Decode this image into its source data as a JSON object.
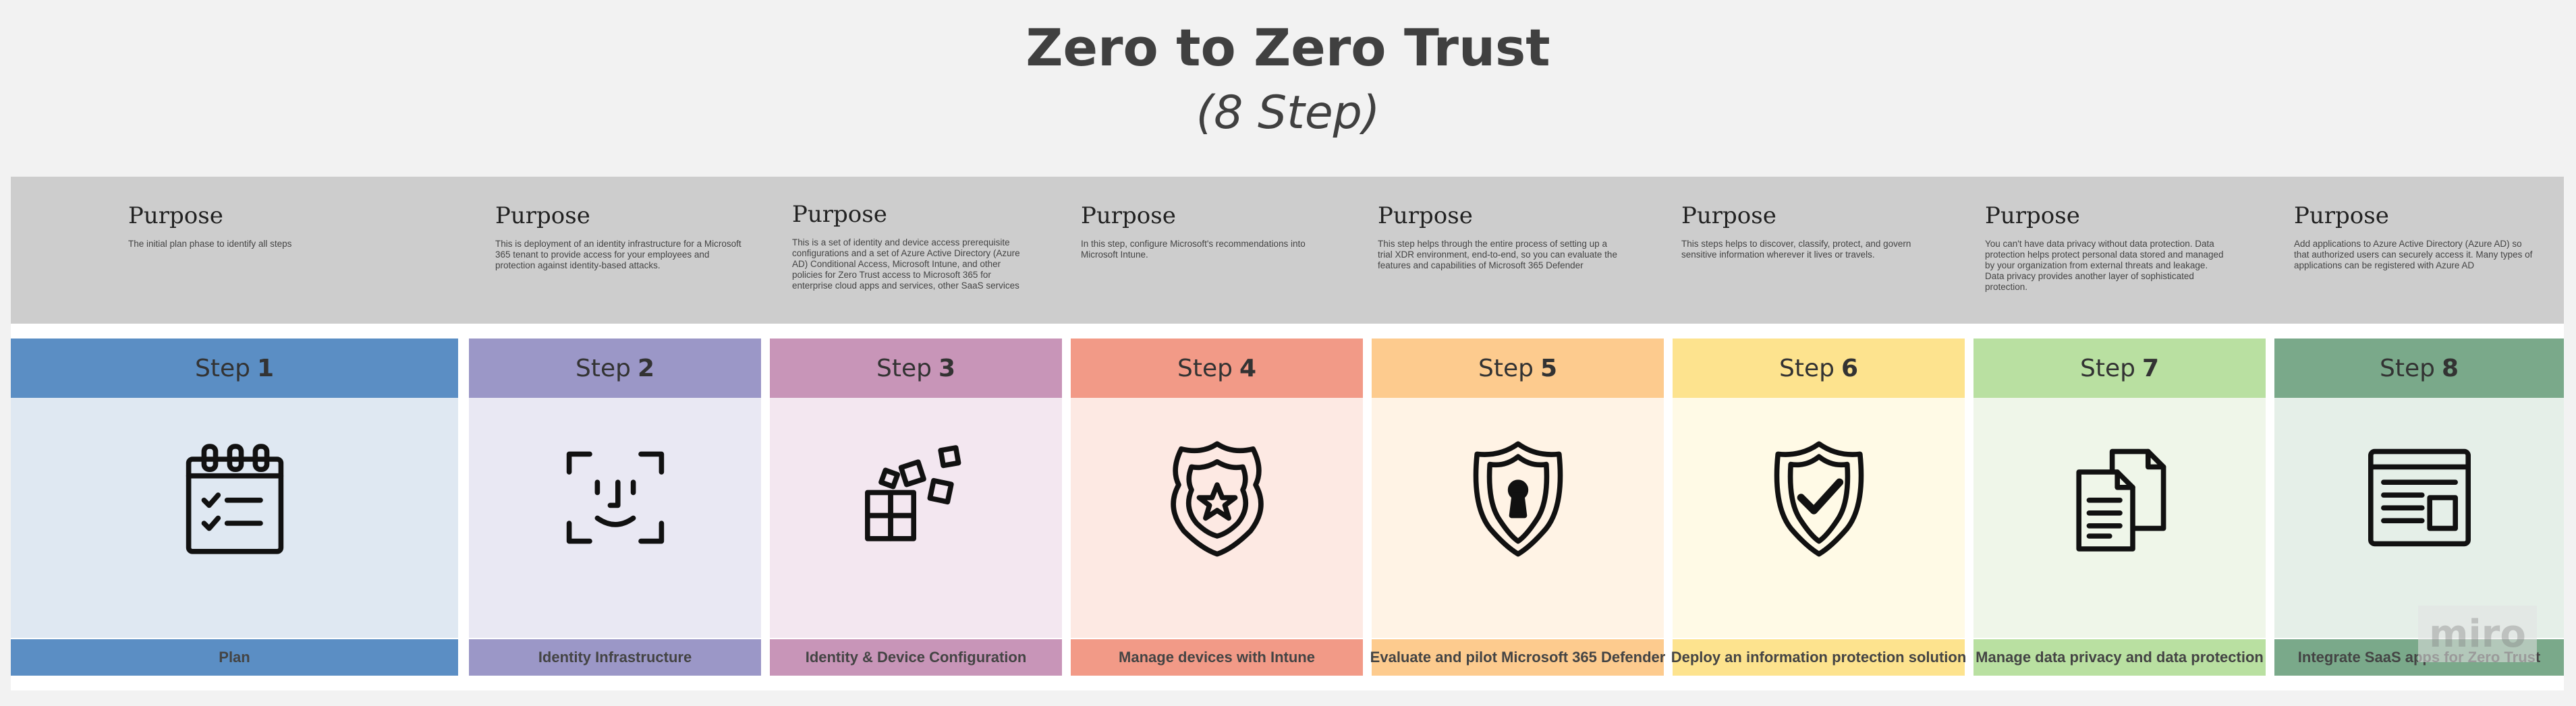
{
  "title": "Zero to Zero Trust",
  "subtitle": "(8 Step)",
  "purposes": [
    {
      "heading": "Purpose",
      "text": "The initial plan phase to identify all steps"
    },
    {
      "heading": "Purpose",
      "text": "This is deployment of an identity infrastructure for a Microsoft 365 tenant to provide access for your employees and protection against identity-based attacks."
    },
    {
      "heading": "Purpose",
      "text": "This is a set of identity and device access prerequisite configurations and a set of Azure Active Directory (Azure AD) Conditional Access, Microsoft Intune, and other policies for Zero Trust access to Microsoft 365 for enterprise cloud apps and services, other SaaS services"
    },
    {
      "heading": "Purpose",
      "text": "In this step, configure Microsoft's recommendations into Microsoft Intune."
    },
    {
      "heading": "Purpose",
      "text": "This step helps through the entire process of setting up a trial XDR environment, end-to-end, so you can evaluate the features and capabilities of Microsoft 365 Defender"
    },
    {
      "heading": "Purpose",
      "text": "This steps helps to discover, classify, protect, and govern sensitive information wherever it lives or travels."
    },
    {
      "heading": "Purpose",
      "text": "You can't have data privacy without data protection. Data protection helps protect personal data stored and managed by your organization from external threats and leakage. Data privacy provides another layer of sophisticated protection."
    },
    {
      "heading": "Purpose",
      "text": "Add applications to Azure Active Directory (Azure AD) so that authorized users can securely access it. Many types of applications can be registered with Azure AD"
    }
  ],
  "steps": [
    {
      "word": "Step",
      "num": "1",
      "label": "Plan",
      "icon": "calendar-icon",
      "head": "#5b8ec4",
      "body": "#dfe8f2"
    },
    {
      "word": "Step",
      "num": "2",
      "label": "Identity Infrastructure",
      "icon": "face-id-icon",
      "head": "#9b97c7",
      "body": "#e9e8f3"
    },
    {
      "word": "Step",
      "num": "3",
      "label": "Identity & Device Configuration",
      "icon": "config-blocks-icon",
      "head": "#c895b8",
      "body": "#f3e7f0"
    },
    {
      "word": "Step",
      "num": "4",
      "label": "Manage devices with Intune",
      "icon": "police-badge-icon",
      "head": "#f29a87",
      "body": "#fde9e3"
    },
    {
      "word": "Step",
      "num": "5",
      "label": "Evaluate and pilot Microsoft 365 Defender",
      "icon": "shield-keyhole-icon",
      "head": "#fdcb8e",
      "body": "#fff3e5"
    },
    {
      "word": "Step",
      "num": "6",
      "label": "Deploy an information protection solution",
      "icon": "shield-check-icon",
      "head": "#fde38e",
      "body": "#fffae6"
    },
    {
      "word": "Step",
      "num": "7",
      "label": "Manage data privacy and data protection",
      "icon": "documents-icon",
      "head": "#b9e0a1",
      "body": "#eff6e9"
    },
    {
      "word": "Step",
      "num": "8",
      "label": "Integrate SaaS apps for Zero Trust",
      "icon": "app-window-icon",
      "head": "#7aa98a",
      "body": "#e5efe8"
    }
  ],
  "watermark": "miro"
}
